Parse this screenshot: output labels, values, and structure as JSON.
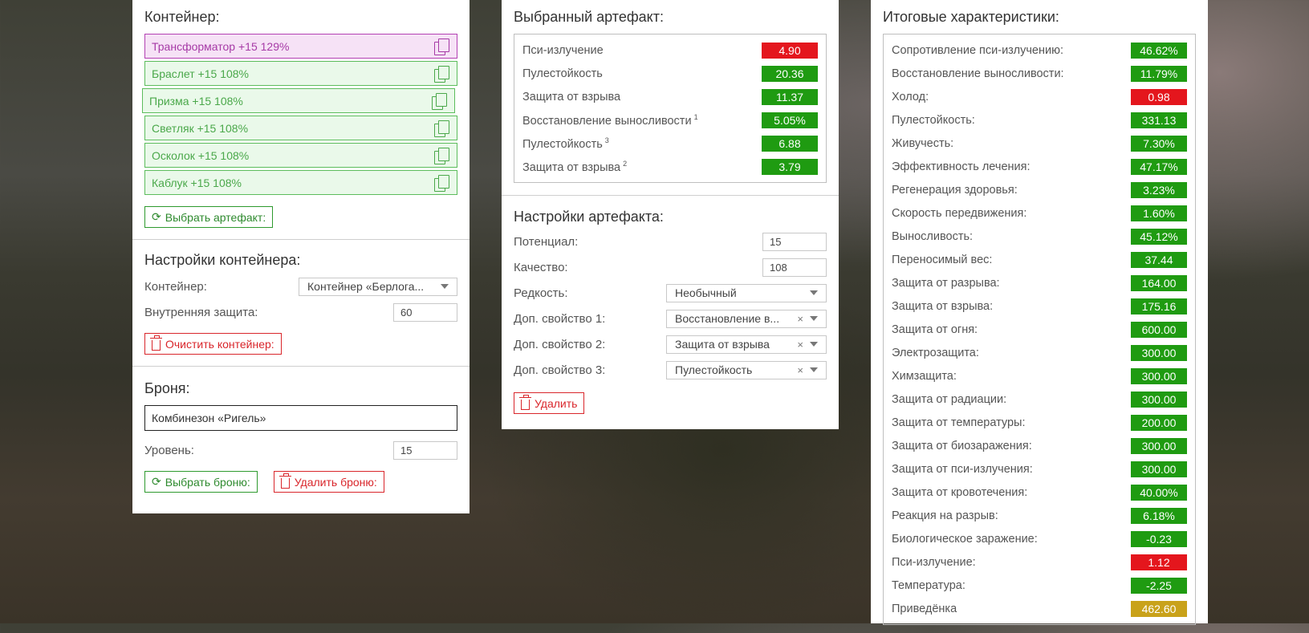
{
  "left": {
    "container_title": "Контейнер:",
    "items": [
      {
        "label": "Трансформатор +15 129%",
        "selected": true
      },
      {
        "label": "Браслет +15 108%",
        "selected": false
      },
      {
        "label": "Призма +15 108%",
        "selected": false
      },
      {
        "label": "Светляк +15 108%",
        "selected": false
      },
      {
        "label": "Осколок +15 108%",
        "selected": false
      },
      {
        "label": "Каблук +15 108%",
        "selected": false
      }
    ],
    "choose_artifact": "Выбрать артефакт:",
    "container_settings_title": "Настройки контейнера:",
    "container_label": "Контейнер:",
    "container_value": "Контейнер «Берлога...",
    "internal_protection_label": "Внутренняя защита:",
    "internal_protection_value": "60",
    "clear_container": "Очистить контейнер:",
    "armor_title": "Броня:",
    "armor_value": "Комбинезон «Ригель»",
    "level_label": "Уровень:",
    "level_value": "15",
    "choose_armor": "Выбрать броню:",
    "delete_armor": "Удалить броню:"
  },
  "mid": {
    "selected_title": "Выбранный артефакт:",
    "stats": [
      {
        "label": "Пси-излучение",
        "sup": "",
        "value": "4.90",
        "color": "red"
      },
      {
        "label": "Пулестойкость",
        "sup": "",
        "value": "20.36",
        "color": "green"
      },
      {
        "label": "Защита от взрыва",
        "sup": "",
        "value": "11.37",
        "color": "green"
      },
      {
        "label": "Восстановление выносливости",
        "sup": "1",
        "value": "5.05%",
        "color": "green"
      },
      {
        "label": "Пулестойкость",
        "sup": "3",
        "value": "6.88",
        "color": "green"
      },
      {
        "label": "Защита от взрыва",
        "sup": "2",
        "value": "3.79",
        "color": "green"
      }
    ],
    "settings_title": "Настройки артефакта:",
    "potential_label": "Потенциал:",
    "potential_value": "15",
    "quality_label": "Качество:",
    "quality_value": "108",
    "rarity_label": "Редкость:",
    "rarity_value": "Необычный",
    "extra1_label": "Доп. свойство 1:",
    "extra1_value": "Восстановление в...",
    "extra2_label": "Доп. свойство 2:",
    "extra2_value": "Защита от взрыва",
    "extra3_label": "Доп. свойство 3:",
    "extra3_value": "Пулестойкость",
    "clear_glyph": "×",
    "delete": "Удалить"
  },
  "right": {
    "title": "Итоговые характеристики:",
    "stats": [
      {
        "label": "Сопротивление пси-излучению:",
        "value": "46.62%",
        "color": "green"
      },
      {
        "label": "Восстановление выносливости:",
        "value": "11.79%",
        "color": "green"
      },
      {
        "label": "Холод:",
        "value": "0.98",
        "color": "red"
      },
      {
        "label": "Пулестойкость:",
        "value": "331.13",
        "color": "green"
      },
      {
        "label": "Живучесть:",
        "value": "7.30%",
        "color": "green"
      },
      {
        "label": "Эффективность лечения:",
        "value": "47.17%",
        "color": "green"
      },
      {
        "label": "Регенерация здоровья:",
        "value": "3.23%",
        "color": "green"
      },
      {
        "label": "Скорость передвижения:",
        "value": "1.60%",
        "color": "green"
      },
      {
        "label": "Выносливость:",
        "value": "45.12%",
        "color": "green"
      },
      {
        "label": "Переносимый вес:",
        "value": "37.44",
        "color": "green"
      },
      {
        "label": "Защита от разрыва:",
        "value": "164.00",
        "color": "green"
      },
      {
        "label": "Защита от взрыва:",
        "value": "175.16",
        "color": "green"
      },
      {
        "label": "Защита от огня:",
        "value": "600.00",
        "color": "green"
      },
      {
        "label": "Электрозащита:",
        "value": "300.00",
        "color": "green"
      },
      {
        "label": "Химзащита:",
        "value": "300.00",
        "color": "green"
      },
      {
        "label": "Защита от радиации:",
        "value": "300.00",
        "color": "green"
      },
      {
        "label": "Защита от температуры:",
        "value": "200.00",
        "color": "green"
      },
      {
        "label": "Защита от биозаражения:",
        "value": "300.00",
        "color": "green"
      },
      {
        "label": "Защита от пси-излучения:",
        "value": "300.00",
        "color": "green"
      },
      {
        "label": "Защита от кровотечения:",
        "value": "40.00%",
        "color": "green"
      },
      {
        "label": "Реакция на разрыв:",
        "value": "6.18%",
        "color": "green"
      },
      {
        "label": "Биологическое заражение:",
        "value": "-0.23",
        "color": "green"
      },
      {
        "label": "Пси-излучение:",
        "value": "1.12",
        "color": "red"
      },
      {
        "label": "Температура:",
        "value": "-2.25",
        "color": "green"
      },
      {
        "label": "Приведёнка",
        "value": "462.60",
        "color": "gold"
      }
    ]
  },
  "icons": {
    "refresh_glyph": "⟳"
  },
  "colors": {
    "green": "#1f9b11",
    "red": "#e4161d",
    "gold": "#c9a21a",
    "selected_item": "#b341b3",
    "item": "#5cbd5c"
  }
}
